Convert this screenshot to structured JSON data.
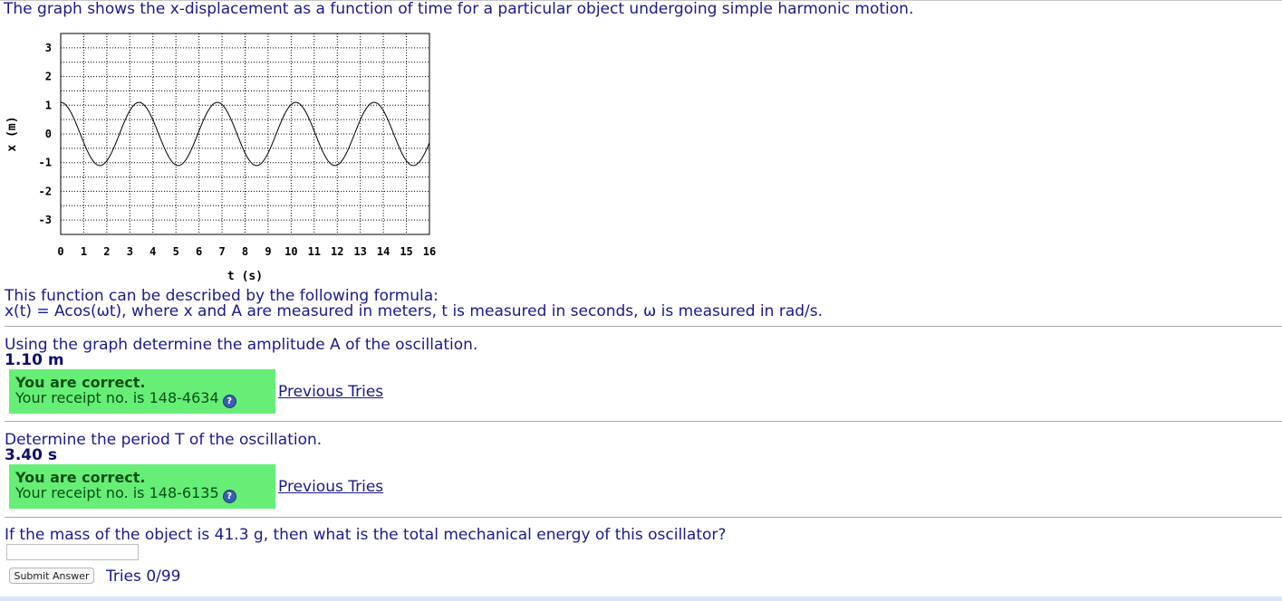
{
  "intro": "The graph shows the x-displacement as a function of time for a particular object undergoing simple harmonic motion.",
  "chart_data": {
    "type": "line",
    "xlabel": "t (s)",
    "ylabel": "x (m)",
    "xlim": [
      0,
      16
    ],
    "ylim": [
      -3.5,
      3.5
    ],
    "x_ticks": [
      "0",
      "1",
      "2",
      "3",
      "4",
      "5",
      "6",
      "7",
      "8",
      "9",
      "10",
      "11",
      "12",
      "13",
      "14",
      "15",
      "16"
    ],
    "y_ticks": [
      "3",
      "2",
      "1",
      "0",
      "-1",
      "-2",
      "-3"
    ],
    "grid": true,
    "series": [
      {
        "formula": "x = A cos(2*pi*t/T)",
        "amplitude": 1.1,
        "period": 3.4,
        "t_range": [
          0,
          16
        ]
      }
    ]
  },
  "formula_intro": "This function can be described by the following formula:",
  "formula_text": "x(t) = Acos(ωt), where x and A are measured in meters, t is measured in seconds, ω is measured in rad/s.",
  "questions": [
    {
      "prompt": "Using the graph determine the amplitude A of the oscillation.",
      "answer": "1.10 m",
      "status": "You are correct.",
      "receipt": "Your receipt no. is 148-4634",
      "previous_tries": "Previous Tries"
    },
    {
      "prompt": "Determine the period T of the oscillation.",
      "answer": "3.40 s",
      "status": "You are correct.",
      "receipt": "Your receipt no. is 148-6135",
      "previous_tries": "Previous Tries"
    },
    {
      "prompt": "If the mass of the object is 41.3 g, then what is the total mechanical energy of this oscillator?",
      "input_value": "",
      "submit_label": "Submit Answer",
      "tries": "Tries 0/99"
    }
  ],
  "help_icon": "question-mark-icon",
  "help_glyph": "?"
}
